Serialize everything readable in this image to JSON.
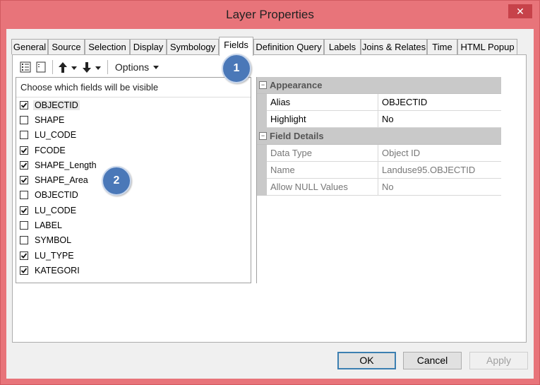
{
  "window": {
    "title": "Layer Properties",
    "close_glyph": "✕"
  },
  "tabs": [
    {
      "label": "General"
    },
    {
      "label": "Source"
    },
    {
      "label": "Selection"
    },
    {
      "label": "Display"
    },
    {
      "label": "Symbology"
    },
    {
      "label": "Fields",
      "active": true
    },
    {
      "label": "Definition Query"
    },
    {
      "label": "Labels"
    },
    {
      "label": "Joins & Relates"
    },
    {
      "label": "Time"
    },
    {
      "label": "HTML Popup"
    }
  ],
  "toolbar": {
    "options_label": "Options",
    "icons": [
      "table-view-icon",
      "list-view-icon",
      "move-up-arrow-icon",
      "move-down-arrow-icon"
    ]
  },
  "callouts": [
    "1",
    "2"
  ],
  "fieldlist": {
    "header": "Choose which fields will be visible",
    "fields": [
      {
        "name": "OBJECTID",
        "checked": true,
        "selected": true
      },
      {
        "name": "SHAPE",
        "checked": false
      },
      {
        "name": "LU_CODE",
        "checked": false
      },
      {
        "name": "FCODE",
        "checked": true
      },
      {
        "name": "SHAPE_Length",
        "checked": true
      },
      {
        "name": "SHAPE_Area",
        "checked": true
      },
      {
        "name": "OBJECTID",
        "checked": false
      },
      {
        "name": "LU_CODE",
        "checked": true
      },
      {
        "name": "LABEL",
        "checked": false
      },
      {
        "name": "SYMBOL",
        "checked": false
      },
      {
        "name": "LU_TYPE",
        "checked": true
      },
      {
        "name": "KATEGORI",
        "checked": true
      }
    ]
  },
  "propgrid": {
    "appearance": {
      "label": "Appearance",
      "alias_name": "Alias",
      "alias_value": "OBJECTID",
      "highlight_name": "Highlight",
      "highlight_value": "No"
    },
    "field_details": {
      "label": "Field Details",
      "data_type_name": "Data Type",
      "data_type_value": "Object ID",
      "name_name": "Name",
      "name_value": "Landuse95.OBJECTID",
      "allow_null_name": "Allow NULL Values",
      "allow_null_value": "No"
    }
  },
  "buttons": {
    "ok": "OK",
    "cancel": "Cancel",
    "apply": "Apply"
  },
  "colors": {
    "titlebar": "#e8747a",
    "close": "#c7424a",
    "callout": "#4a78b8"
  }
}
